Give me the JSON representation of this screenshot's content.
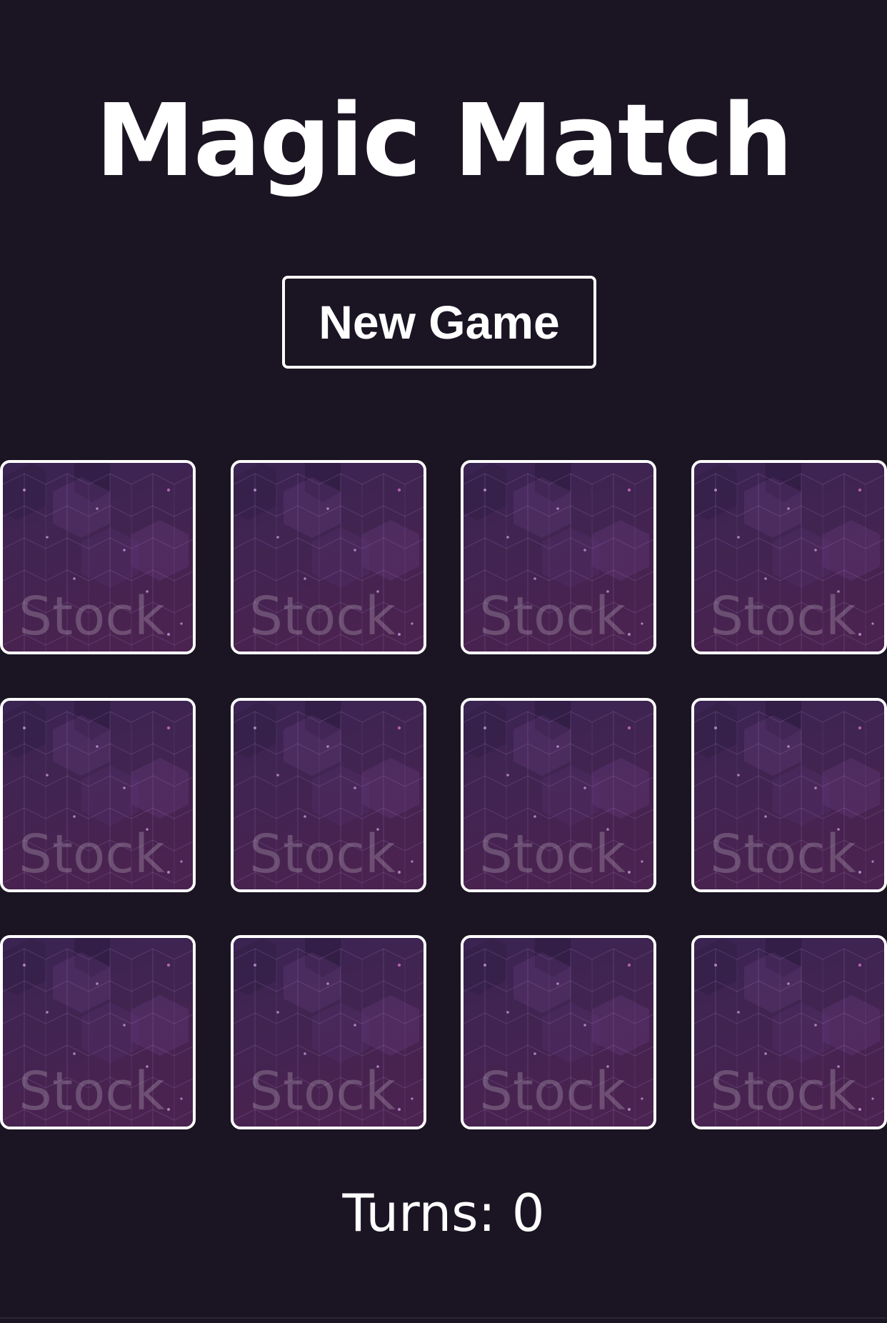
{
  "app": {
    "title": "Magic Match"
  },
  "controls": {
    "new_game_label": "New Game"
  },
  "board": {
    "rows": 3,
    "columns": 4,
    "cards": [
      {
        "state": "face-down",
        "back_watermark": "Stock"
      },
      {
        "state": "face-down",
        "back_watermark": "Stock"
      },
      {
        "state": "face-down",
        "back_watermark": "Stock"
      },
      {
        "state": "face-down",
        "back_watermark": "Stock"
      },
      {
        "state": "face-down",
        "back_watermark": "Stock"
      },
      {
        "state": "face-down",
        "back_watermark": "Stock"
      },
      {
        "state": "face-down",
        "back_watermark": "Stock"
      },
      {
        "state": "face-down",
        "back_watermark": "Stock"
      },
      {
        "state": "face-down",
        "back_watermark": "Stock"
      },
      {
        "state": "face-down",
        "back_watermark": "Stock"
      },
      {
        "state": "face-down",
        "back_watermark": "Stock"
      },
      {
        "state": "face-down",
        "back_watermark": "Stock"
      }
    ]
  },
  "status": {
    "turns_label": "Turns: ",
    "turns_value": "0"
  },
  "theme": {
    "background": "#1b1523",
    "card_border": "#ffffff",
    "card_back_top": "#3a2452",
    "card_back_bottom": "#4a2350"
  }
}
